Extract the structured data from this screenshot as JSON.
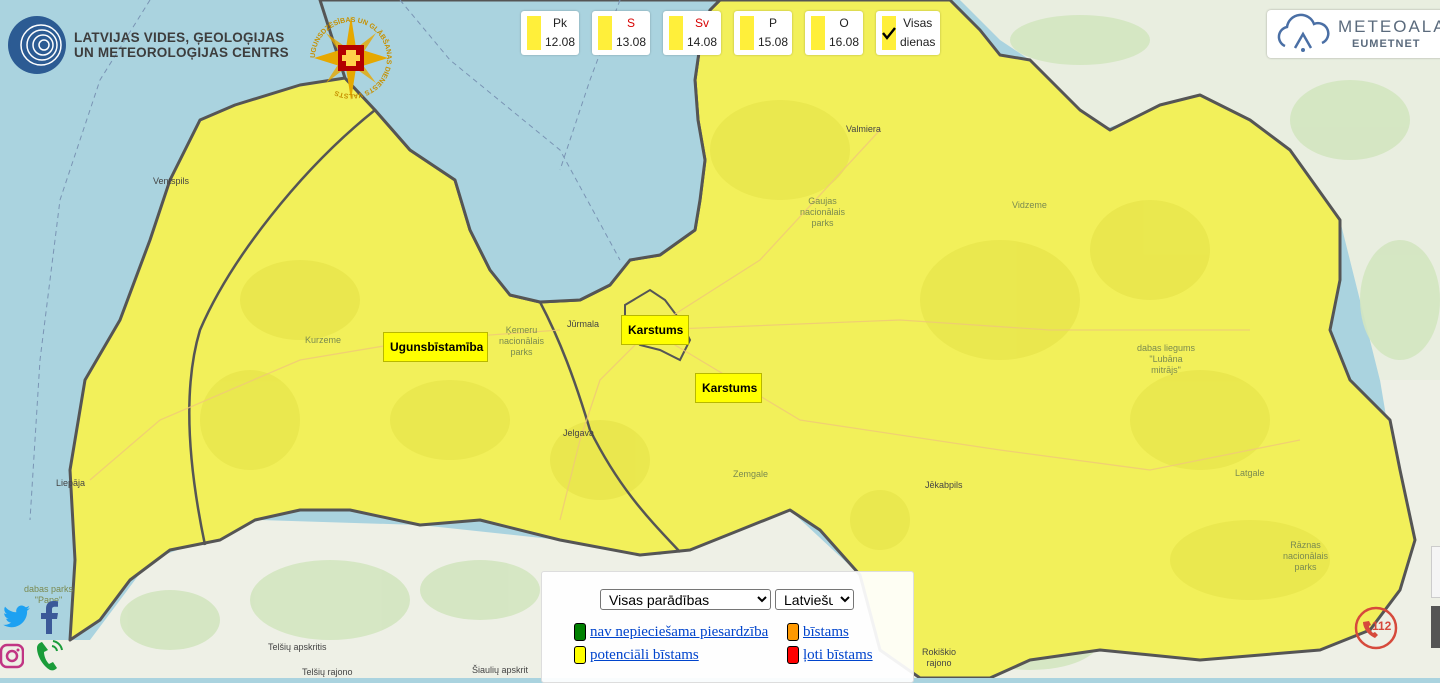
{
  "org": {
    "name_line1": "LATVIJAS VIDES, ĢEOLOĢIJAS",
    "name_line2": "UN METEOROLOĢIJAS CENTRS"
  },
  "emblem": {
    "ring_text": "UGUNSDZĒSĪBAS UN GLĀBŠANAS DIENESTS VALSTS"
  },
  "days": [
    {
      "weekday": "Pk",
      "date": "12.08",
      "weekend": false
    },
    {
      "weekday": "S",
      "date": "13.08",
      "weekend": true
    },
    {
      "weekday": "Sv",
      "date": "14.08",
      "weekend": true
    },
    {
      "weekday": "P",
      "date": "15.08",
      "weekend": false
    },
    {
      "weekday": "O",
      "date": "16.08",
      "weekend": false
    }
  ],
  "all_days": {
    "line1": "Visas",
    "line2": "dienas",
    "checked": true
  },
  "meteoalarm": {
    "title": "METEOALA",
    "subtitle": "EUMETNET"
  },
  "warnings": [
    {
      "label": "Ugunsbīstamība"
    },
    {
      "label": "Karstums"
    },
    {
      "label": "Karstums"
    }
  ],
  "places": {
    "valmiera": "Valmiera",
    "ventspils": "Ventspils",
    "gauja": [
      "Gaujas",
      "nacionālais",
      "parks"
    ],
    "vidzeme": "Vidzeme",
    "jurmala": "Jūrmala",
    "kemeri": [
      "Ķemeru",
      "nacionālais",
      "parks"
    ],
    "kurzeme": "Kurzeme",
    "lubana": [
      "dabas liegums",
      "\"Lubāna",
      "mitrājs\""
    ],
    "jelgava": "Jelgava",
    "zemgale": "Zemgale",
    "jekabpils": "Jēkabpils",
    "latgale": "Latgale",
    "liepaja": "Liepāja",
    "razna": [
      "Rāznas",
      "nacionālais",
      "parks"
    ],
    "pape": [
      "dabas parks",
      "\"Pape\""
    ],
    "telsiai": "Telšių apskritis",
    "telsiai_r": "Telšių rajono",
    "siauliai": "Šiaulių apskrit",
    "rokiskio": [
      "Rokiškio",
      "rajono"
    ]
  },
  "filter": {
    "phenomena": "Visas parādības",
    "language": "Latviešu"
  },
  "legend": {
    "green": "nav nepieciešama piesardzība",
    "orange": "bīstams",
    "yellow": "potenciāli bīstams",
    "red": "ļoti bīstams"
  },
  "emergency": {
    "number": "112"
  },
  "colors": {
    "sea": "#aad3df",
    "land_outside": "#eef0e6",
    "warning_yellow": "#f2f05a",
    "border": "#555555",
    "legend_green": "#008000",
    "legend_orange": "#ff9900",
    "legend_yellow": "#ffff00",
    "legend_red": "#ff0000"
  },
  "icons": [
    "twitter-icon",
    "facebook-icon",
    "instagram-icon",
    "phone-icon",
    "emergency-112-icon",
    "checkmark-icon"
  ]
}
